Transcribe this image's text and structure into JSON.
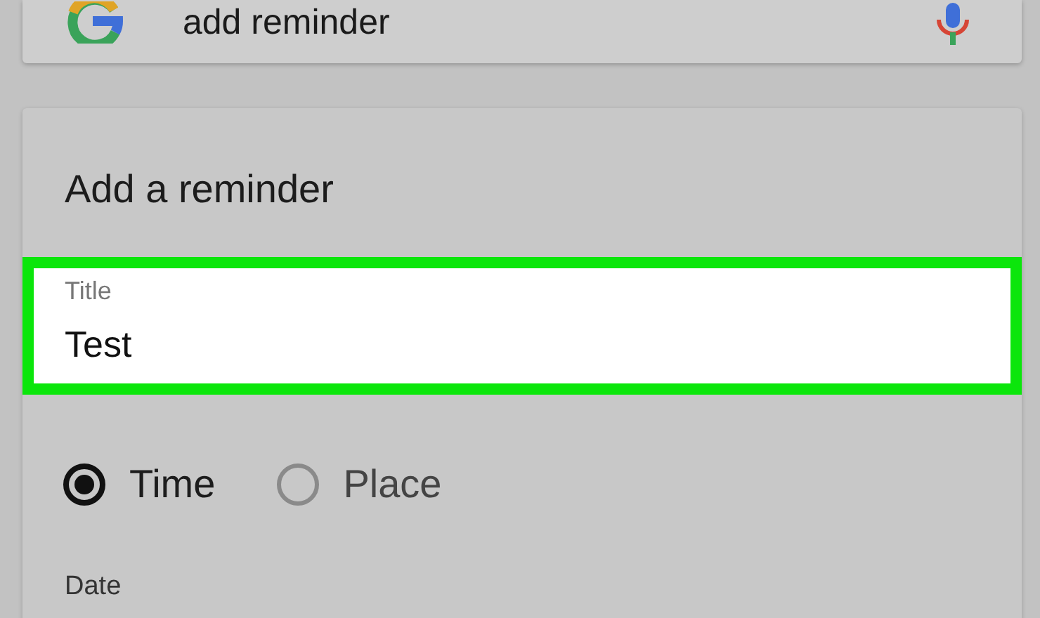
{
  "search_bar": {
    "query": "add reminder"
  },
  "reminder_card": {
    "heading": "Add a reminder",
    "title_field": {
      "label": "Title",
      "value": "Test",
      "highlighted": true
    },
    "trigger_options": [
      {
        "label": "Time",
        "selected": true
      },
      {
        "label": "Place",
        "selected": false
      }
    ],
    "date_label": "Date"
  }
}
